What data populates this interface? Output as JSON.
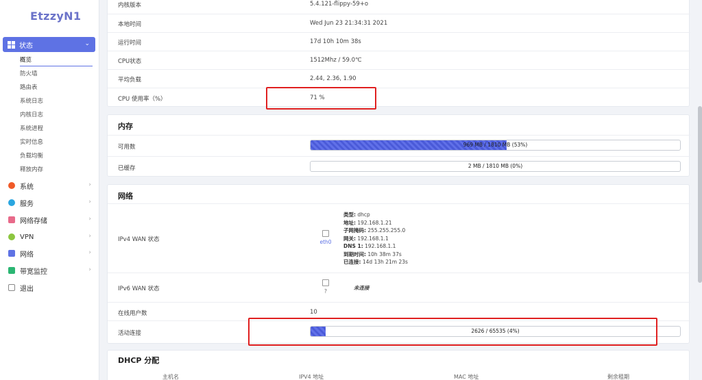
{
  "logo": "EtzzyN1",
  "sidebar": {
    "active_menu": "状态",
    "submenu": [
      "概览",
      "防火墙",
      "路由表",
      "系统日志",
      "内核日志",
      "系统进程",
      "实时信息",
      "负载均衡",
      "释放内存"
    ],
    "items": [
      {
        "label": "系统",
        "color": "#f05a28"
      },
      {
        "label": "服务",
        "color": "#2aa6e0"
      },
      {
        "label": "网络存储",
        "color": "#e86a8a"
      },
      {
        "label": "VPN",
        "color": "#8cc63f"
      },
      {
        "label": "网络",
        "color": "#5e72e4"
      },
      {
        "label": "带宽监控",
        "color": "#2bb673"
      },
      {
        "label": "退出",
        "color": "#888888"
      }
    ]
  },
  "system": {
    "rows": [
      {
        "k": "内核版本",
        "v": "5.4.121-flippy-59+o"
      },
      {
        "k": "本地时间",
        "v": "Wed Jun 23 21:34:31 2021"
      },
      {
        "k": "运行时间",
        "v": "17d 10h 10m 38s"
      },
      {
        "k": "CPU状态",
        "v": "1512Mhz / 59.0℃"
      },
      {
        "k": "平均负载",
        "v": "2.44, 2.36, 1.90"
      },
      {
        "k": "CPU 使用率（%）",
        "v": "71 %"
      }
    ]
  },
  "memory": {
    "title": "内存",
    "available_label": "可用数",
    "available_text": "969 MB / 1810 MB (53%)",
    "available_fraction": 0.53,
    "cached_label": "已缓存",
    "cached_text": "2 MB / 1810 MB (0%)",
    "cached_fraction": 0.0
  },
  "network": {
    "title": "网络",
    "ipv4_label": "IPv4 WAN 状态",
    "ipv4_iface": "eth0",
    "ipv4_info": [
      {
        "k": "类型:",
        "v": "dhcp"
      },
      {
        "k": "地址:",
        "v": "192.168.1.21"
      },
      {
        "k": "子网掩码:",
        "v": "255.255.255.0"
      },
      {
        "k": "网关:",
        "v": "192.168.1.1"
      },
      {
        "k": "DNS 1:",
        "v": "192.168.1.1"
      },
      {
        "k": "到期时间:",
        "v": "10h 38m 37s"
      },
      {
        "k": "已连接:",
        "v": "14d 13h 21m 23s"
      }
    ],
    "ipv6_label": "IPv6 WAN 状态",
    "ipv6_iface": "?",
    "ipv6_status": "未连接",
    "users_label": "在线用户数",
    "users_value": "10",
    "conn_label": "活动连接",
    "conn_text": "2626 / 65535 (4%)",
    "conn_fraction": 0.04
  },
  "dhcp": {
    "title": "DHCP 分配",
    "columns": [
      "主机名",
      "IPV4 地址",
      "MAC 地址",
      "剩余租期"
    ]
  }
}
